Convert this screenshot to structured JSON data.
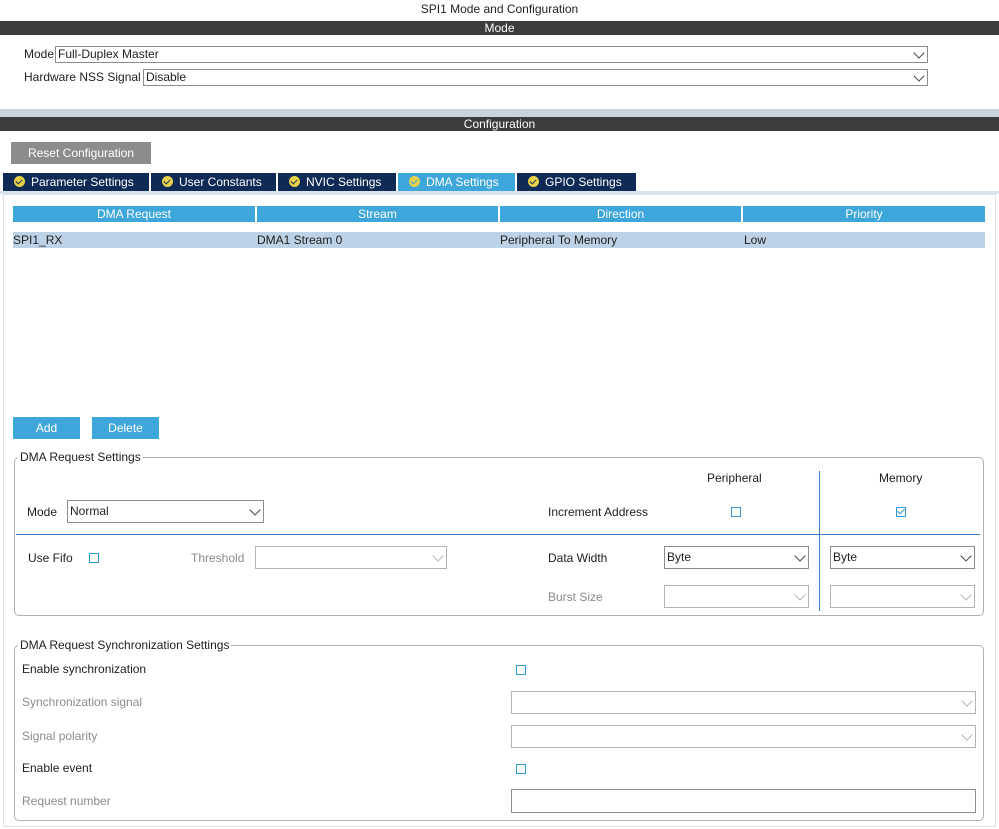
{
  "window_title": "SPI1 Mode and Configuration",
  "mode_section": {
    "header": "Mode",
    "mode_label": "Mode",
    "mode_value": "Full-Duplex Master",
    "nss_label": "Hardware NSS Signal",
    "nss_value": "Disable"
  },
  "config_section": {
    "header": "Configuration",
    "reset_button": "Reset Configuration",
    "tabs": [
      {
        "label": "Parameter Settings",
        "active": false
      },
      {
        "label": "User Constants",
        "active": false
      },
      {
        "label": "NVIC Settings",
        "active": false
      },
      {
        "label": "DMA Settings",
        "active": true
      },
      {
        "label": "GPIO Settings",
        "active": false
      }
    ]
  },
  "dma_table": {
    "columns": [
      "DMA Request",
      "Stream",
      "Direction",
      "Priority"
    ],
    "rows": [
      {
        "request": "SPI1_RX",
        "stream": "DMA1 Stream 0",
        "direction": "Peripheral To Memory",
        "priority": "Low"
      }
    ]
  },
  "table_buttons": {
    "add": "Add",
    "delete": "Delete"
  },
  "dma_request_settings": {
    "title": "DMA Request Settings",
    "peripheral_header": "Peripheral",
    "memory_header": "Memory",
    "mode_label": "Mode",
    "mode_value": "Normal",
    "increment_address_label": "Increment Address",
    "peripheral_increment": false,
    "memory_increment": true,
    "use_fifo_label": "Use Fifo",
    "use_fifo": false,
    "threshold_label": "Threshold",
    "threshold_value": "",
    "data_width_label": "Data Width",
    "peripheral_data_width": "Byte",
    "memory_data_width": "Byte",
    "burst_size_label": "Burst Size",
    "peripheral_burst_size": "",
    "memory_burst_size": ""
  },
  "sync_settings": {
    "title": "DMA Request Synchronization Settings",
    "enable_sync_label": "Enable synchronization",
    "enable_sync": false,
    "sync_signal_label": "Synchronization signal",
    "sync_signal_value": "",
    "signal_polarity_label": "Signal polarity",
    "signal_polarity_value": "",
    "enable_event_label": "Enable event",
    "enable_event": false,
    "request_number_label": "Request number",
    "request_number_value": ""
  },
  "icons": {
    "tab_status": "check-circle-icon",
    "dropdown": "chevron-down-icon",
    "checkbox": "checkbox-icon"
  },
  "colors": {
    "accent": "#3da6db",
    "tab_bg": "#0f2a55",
    "header_bar": "#3c3c3c",
    "selected_row": "#bcd2e6",
    "tab_check": "#e8d24a"
  }
}
